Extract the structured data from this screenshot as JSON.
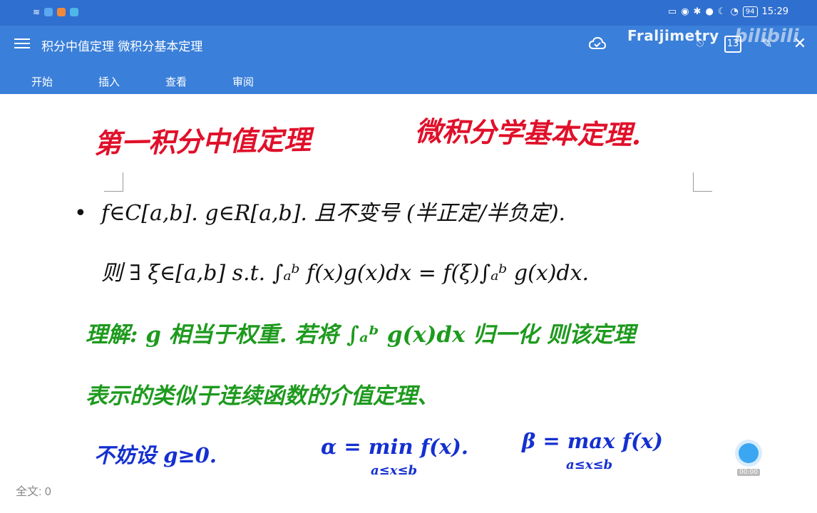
{
  "status": {
    "time": "15:29",
    "battery": "94"
  },
  "app": {
    "doc_title": "积分中值定理 微积分基本定理",
    "brand": "Fraljimetry",
    "watermark": "bilibili",
    "tab_count": "13",
    "tabs": [
      "开始",
      "插入",
      "查看",
      "审阅"
    ]
  },
  "page": {
    "red_left": "第一积分中值定理",
    "red_right": "微积分学基本定理.",
    "line1_bullet": "•",
    "line1": "f∈C[a,b].  g∈R[a,b]. 且不变号 (半正定/半负定).",
    "line2": "则 ∃ ξ∈[a,b]  s.t.  ∫ₐᵇ f(x)g(x)dx = f(ξ)∫ₐᵇ g(x)dx.",
    "green1": "理解: g 相当于权重. 若将 ∫ₐᵇ g(x)dx 归一化  则该定理",
    "green2": "表示的类似于连续函数的介值定理、",
    "blue_left": "不妨设  g≥0.",
    "blue_alpha": "α = min f(x).",
    "blue_alpha_sub": "a≤x≤b",
    "blue_beta": "β = max f(x)",
    "blue_beta_sub": "a≤x≤b",
    "word_count": "全文: 0",
    "float_label": "00:00"
  },
  "colors": {
    "appbar": "#3a7fd9",
    "statusbar": "#2f6fcf",
    "red_ink": "#e0102a",
    "green_ink": "#1e9a1e",
    "blue_ink": "#1530d0"
  }
}
